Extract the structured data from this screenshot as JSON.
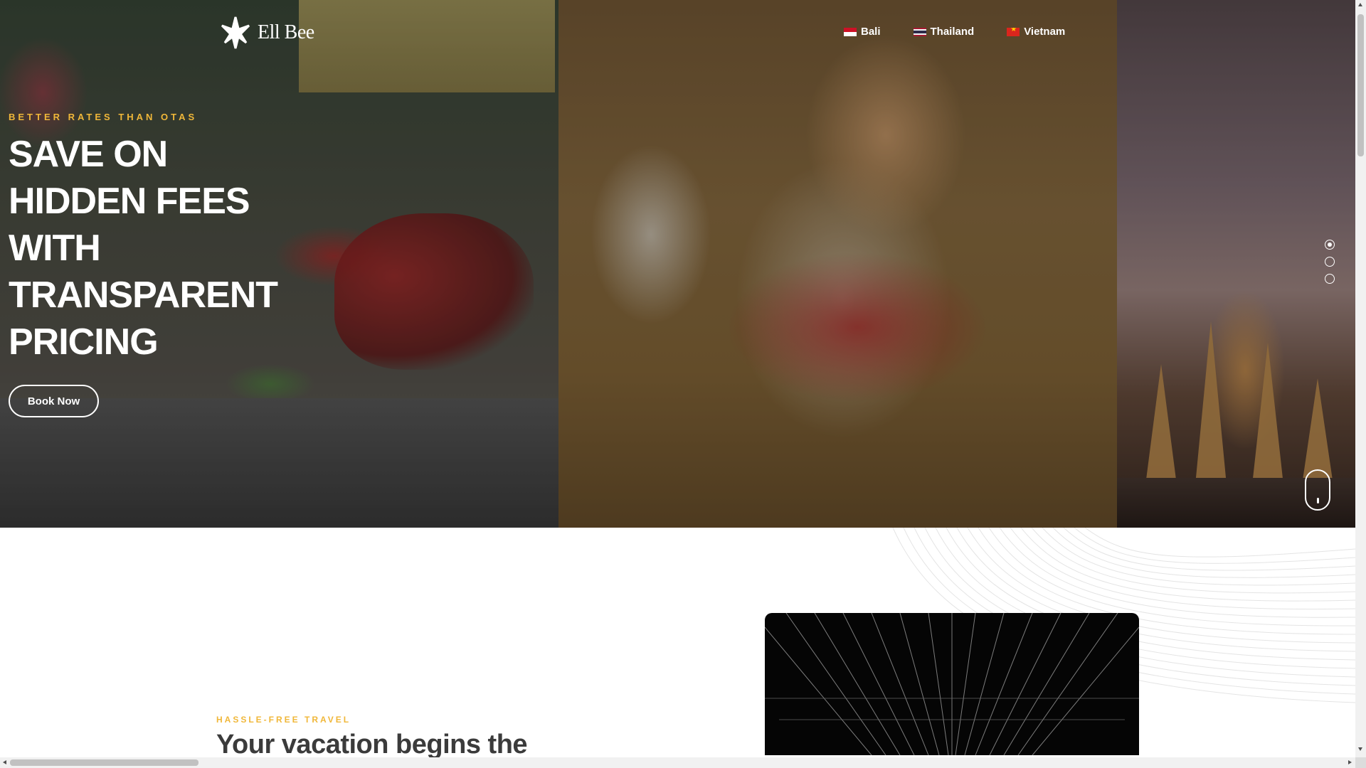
{
  "brand": {
    "name": "Ell Bee",
    "logo_icon": "ellbee-star-logo-icon"
  },
  "nav": {
    "items": [
      {
        "label": "Bali",
        "flag": "indonesia-flag-icon"
      },
      {
        "label": "Thailand",
        "flag": "thailand-flag-icon"
      },
      {
        "label": "Vietnam",
        "flag": "vietnam-flag-icon"
      }
    ]
  },
  "hero": {
    "eyebrow": "BETTER RATES THAN OTAS",
    "headline_lines": [
      "SAVE ON",
      "HIDDEN FEES",
      "WITH",
      "TRANSPARENT",
      "PRICING"
    ],
    "cta_label": "Book Now",
    "slides_total": 3,
    "active_slide": 1
  },
  "intro": {
    "eyebrow": "HASSLE-FREE TRAVEL",
    "heading": "Your vacation begins the"
  },
  "colors": {
    "accent": "#f0b739",
    "heading_text": "#3b3b3b",
    "hero_text": "#ffffff",
    "video_bg": "#050505"
  }
}
